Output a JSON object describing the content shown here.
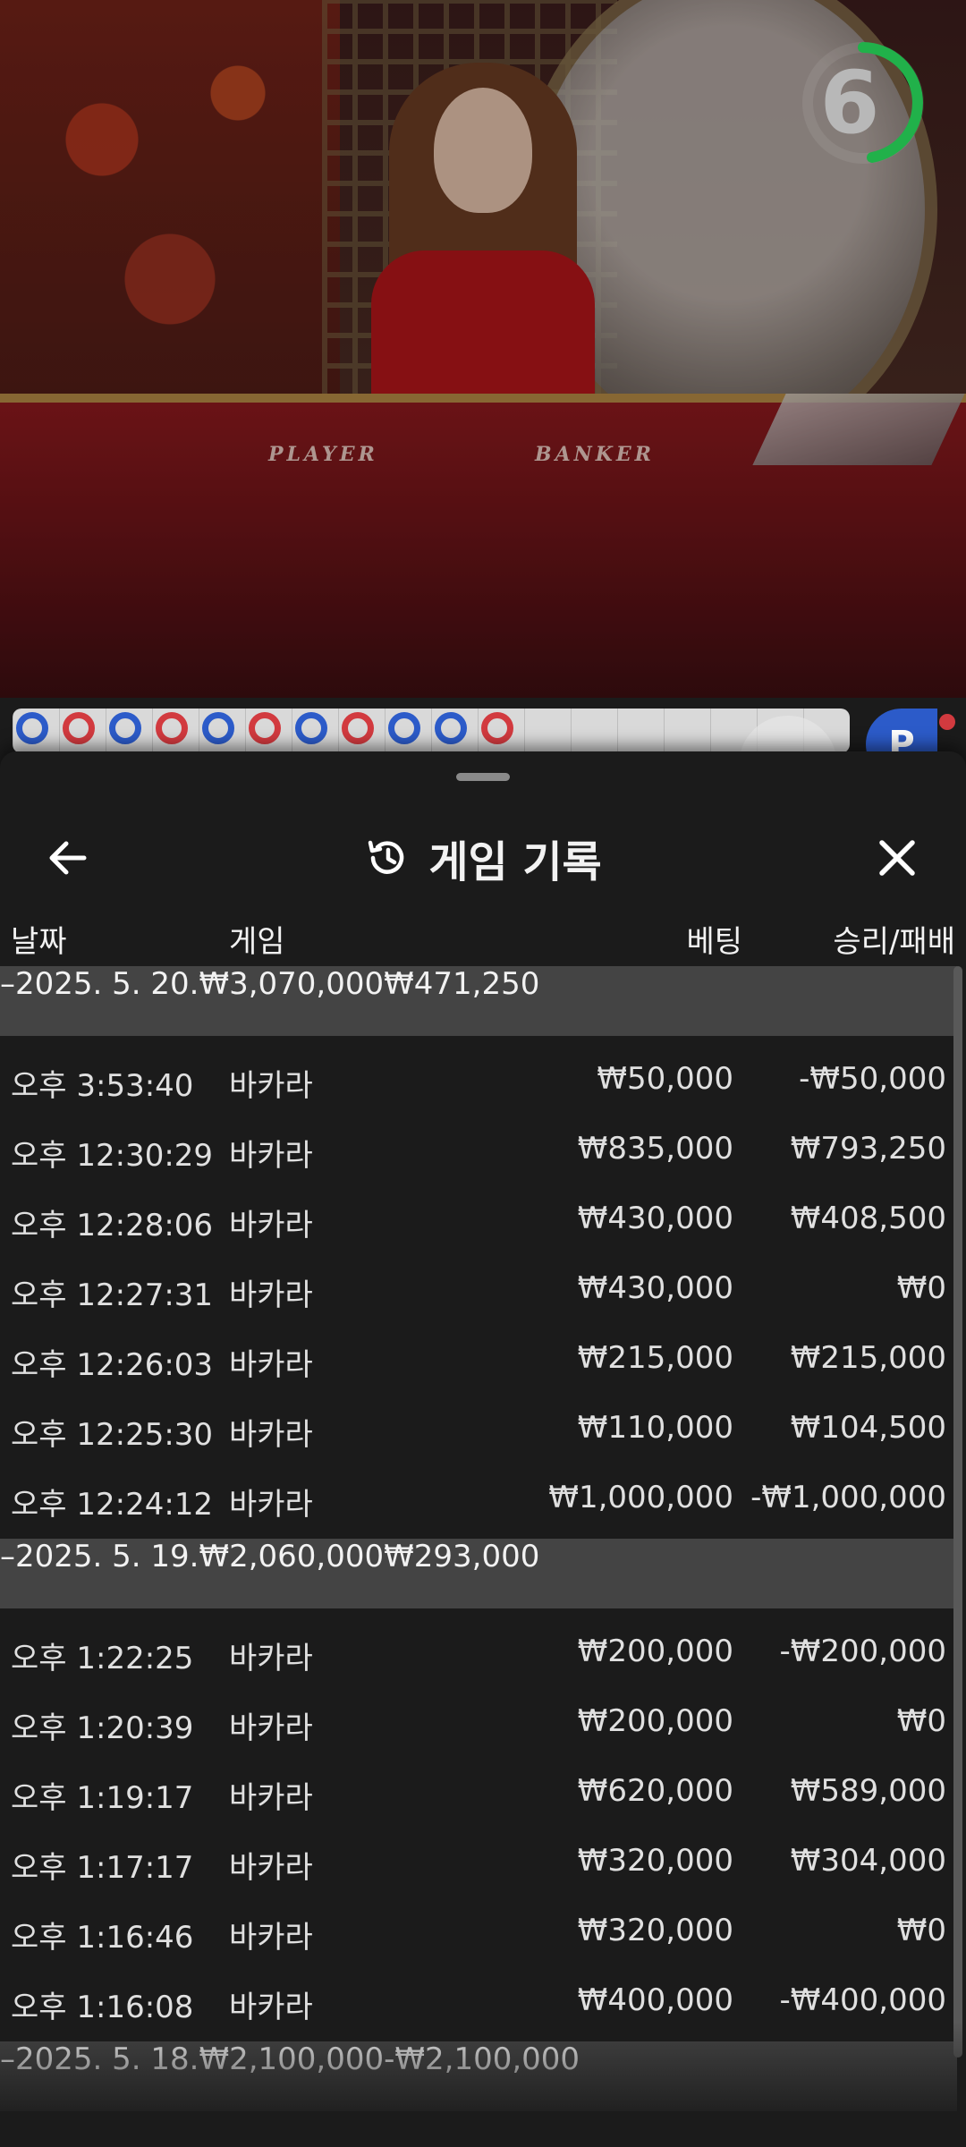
{
  "timer": {
    "value": "6",
    "accent": "#21b14a"
  },
  "table": {
    "player_label": "PLAYER",
    "banker_label": "BANKER"
  },
  "roadmap": {
    "beads": [
      "P",
      "B",
      "P",
      "B",
      "P",
      "B",
      "P",
      "B",
      "P",
      "P",
      "B"
    ],
    "player_color": "#2c5bc9",
    "banker_color": "#d23a3f",
    "badge": "P"
  },
  "sheet": {
    "title": "게임 기록",
    "back_icon": "arrow-left-icon",
    "close_icon": "close-icon",
    "history_icon": "history-icon",
    "columns": {
      "date": "날짜",
      "game": "게임",
      "bet": "베팅",
      "win": "승리/패배"
    },
    "groups": [
      {
        "date": "–2025. 5. 20.",
        "bet": "₩3,070,000",
        "win": "₩471,250",
        "rows": [
          {
            "time": "오후 3:53:40",
            "game": "바카라",
            "bet": "₩50,000",
            "win": "-₩50,000"
          },
          {
            "time": "오후 12:30:29",
            "game": "바카라",
            "bet": "₩835,000",
            "win": "₩793,250"
          },
          {
            "time": "오후 12:28:06",
            "game": "바카라",
            "bet": "₩430,000",
            "win": "₩408,500"
          },
          {
            "time": "오후 12:27:31",
            "game": "바카라",
            "bet": "₩430,000",
            "win": "₩0"
          },
          {
            "time": "오후 12:26:03",
            "game": "바카라",
            "bet": "₩215,000",
            "win": "₩215,000"
          },
          {
            "time": "오후 12:25:30",
            "game": "바카라",
            "bet": "₩110,000",
            "win": "₩104,500"
          },
          {
            "time": "오후 12:24:12",
            "game": "바카라",
            "bet": "₩1,000,000",
            "win": "-₩1,000,000"
          }
        ]
      },
      {
        "date": "–2025. 5. 19.",
        "bet": "₩2,060,000",
        "win": "₩293,000",
        "rows": [
          {
            "time": "오후 1:22:25",
            "game": "바카라",
            "bet": "₩200,000",
            "win": "-₩200,000"
          },
          {
            "time": "오후 1:20:39",
            "game": "바카라",
            "bet": "₩200,000",
            "win": "₩0"
          },
          {
            "time": "오후 1:19:17",
            "game": "바카라",
            "bet": "₩620,000",
            "win": "₩589,000"
          },
          {
            "time": "오후 1:17:17",
            "game": "바카라",
            "bet": "₩320,000",
            "win": "₩304,000"
          },
          {
            "time": "오후 1:16:46",
            "game": "바카라",
            "bet": "₩320,000",
            "win": "₩0"
          },
          {
            "time": "오후 1:16:08",
            "game": "바카라",
            "bet": "₩400,000",
            "win": "-₩400,000"
          }
        ]
      },
      {
        "date": "–2025. 5. 18.",
        "bet": "₩2,100,000",
        "win": "-₩2,100,000",
        "rows": []
      }
    ]
  }
}
